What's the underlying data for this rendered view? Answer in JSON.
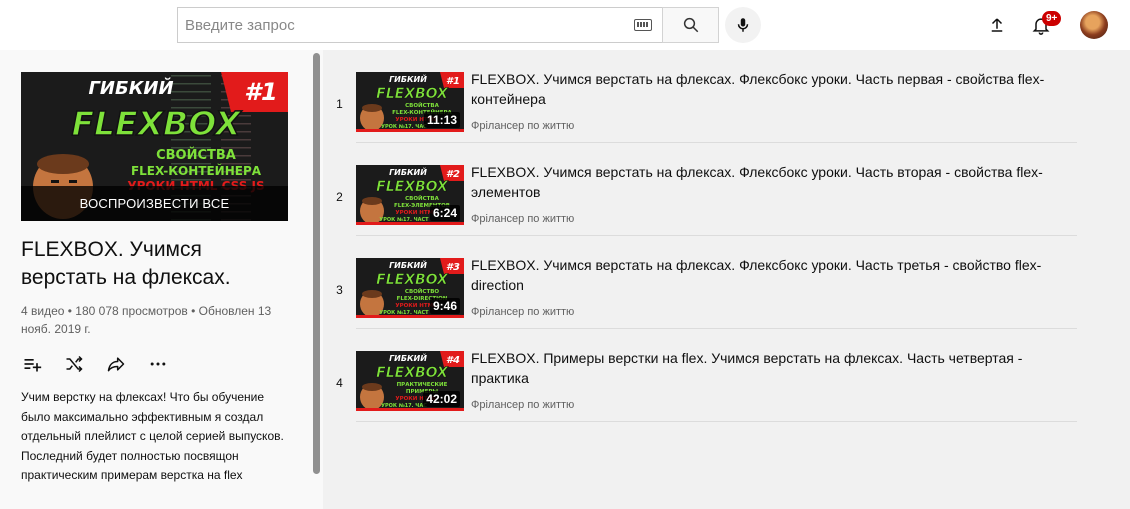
{
  "header": {
    "search_placeholder": "Введите запрос",
    "notification_count": "9+"
  },
  "playlist": {
    "play_all_label": "ВОСПРОИЗВЕСТИ ВСЕ",
    "title": "FLEXBOX. Учимся верстать на флексах.",
    "stats": "4 видео • 180 078 просмотров • Обновлен 13 нояб. 2019 г.",
    "description": "Учим верстку на флексах! Что бы обучение было максимально эффективным я создал отдельный плейлист с целой серией выпусков. Последний будет полностью посвящон практическим примерам верстка на flex",
    "thumbnail": {
      "top_text": "ГИБКИЙ",
      "number": "#1",
      "big_text": "FLEXBOX",
      "line1": "СВОЙСТВА",
      "line2": "FLEX-КОНТЕЙНЕРА",
      "line3": "УРОКИ HTML CSS JS"
    }
  },
  "videos": [
    {
      "index": "1",
      "title": "FLEXBOX. Учимся верстать на флексах. Флексбокс уроки. Часть первая - свойства flex-контейнера",
      "channel": "Фрілансер по життю",
      "duration": "11:13",
      "thumb": {
        "top": "ГИБКИЙ",
        "num": "#1",
        "big": "FLEXBOX",
        "l1": "СВОЙСТВА",
        "l2": "FLEX-КОНТЕЙНЕРА",
        "l3": "УРОКИ HTML",
        "l4": "УРОК №17. ЧАС"
      }
    },
    {
      "index": "2",
      "title": "FLEXBOX. Учимся верстать на флексах. Флексбокс уроки. Часть вторая - свойства flex-элементов",
      "channel": "Фрілансер по життю",
      "duration": "6:24",
      "thumb": {
        "top": "ГИБКИЙ",
        "num": "#2",
        "big": "FLEXBOX",
        "l1": "СВОЙСТВА",
        "l2": "FLEX-ЭЛЕМЕНТОВ",
        "l3": "УРОКИ HTML",
        "l4": "УРОК №17. ЧАСТ"
      }
    },
    {
      "index": "3",
      "title": "FLEXBOX. Учимся верстать на флексах. Флексбокс уроки. Часть третья - свойство flex-direction",
      "channel": "Фрілансер по життю",
      "duration": "9:46",
      "thumb": {
        "top": "ГИБКИЙ",
        "num": "#3",
        "big": "FLEXBOX",
        "l1": "СВОЙСТВО",
        "l2": "FLEX-DIRECTION",
        "l3": "УРОКИ HTML",
        "l4": "УРОК №17. ЧАСТ"
      }
    },
    {
      "index": "4",
      "title": "FLEXBOX. Примеры верстки на flex. Учимся верстать на флексах. Часть четвертая - практика",
      "channel": "Фрілансер по життю",
      "duration": "42:02",
      "thumb": {
        "top": "ГИБКИЙ",
        "num": "#4",
        "big": "FLEXBOX",
        "l1": "ПРАКТИЧЕСКИЕ",
        "l2": "ПРИМЕРЫ",
        "l3": "УРОКИ HTML",
        "l4": "УРОК №17. ЧАС"
      }
    }
  ],
  "icons": {
    "keyboard": "keyboard-icon",
    "search": "search-icon",
    "mic": "mic-icon",
    "upload": "upload-icon",
    "bell": "bell-icon",
    "add_queue": "add-to-queue-icon",
    "shuffle": "shuffle-icon",
    "share": "share-icon",
    "more": "more-icon"
  },
  "colors": {
    "badge": "#cc0000",
    "thumb_green": "#7ee13a",
    "thumb_red": "#e21b1b"
  }
}
